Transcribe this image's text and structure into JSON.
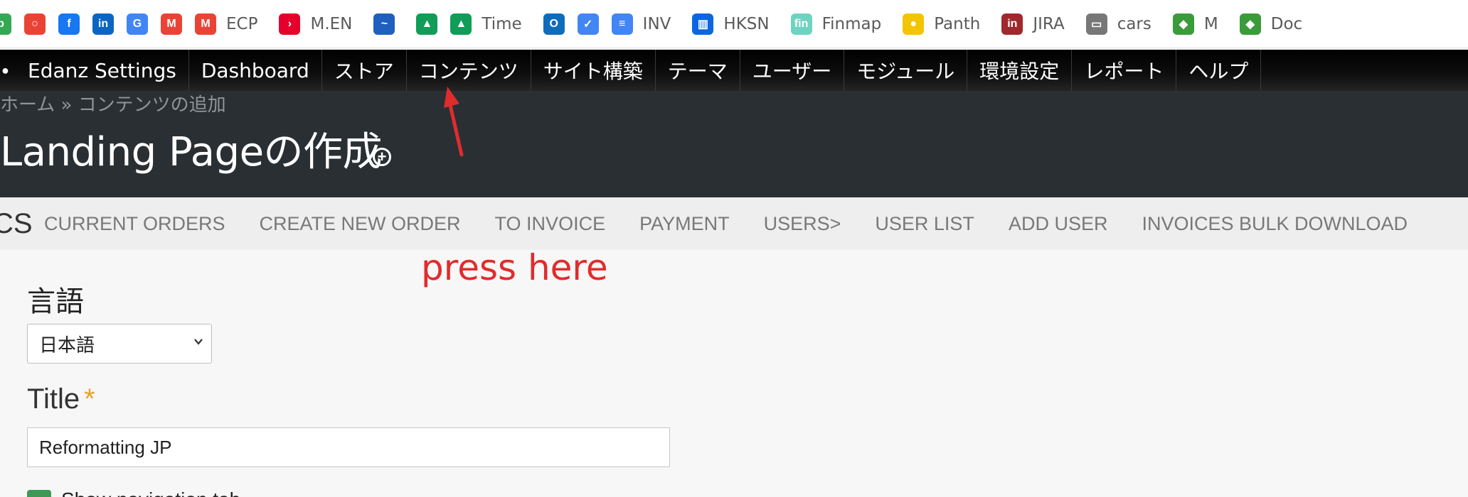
{
  "bookmarks": [
    {
      "icon": "app-icon",
      "label": "",
      "color": "#34a853"
    },
    {
      "icon": "circle-icon",
      "label": "",
      "color": "#ea4335"
    },
    {
      "icon": "facebook-icon",
      "label": "",
      "color": "#1877f2"
    },
    {
      "icon": "linkedin-icon",
      "label": "",
      "color": "#0a66c2"
    },
    {
      "icon": "translate-icon",
      "label": "",
      "color": "#4285f4"
    },
    {
      "icon": "gmail-icon",
      "label": "",
      "color": "#ea4335"
    },
    {
      "icon": "gmail-icon",
      "label": "ECP",
      "color": "#ea4335"
    },
    {
      "icon": "chevron-icon",
      "label": "M.EN",
      "color": "#e4002b"
    },
    {
      "icon": "chart-icon",
      "label": "",
      "color": "#1f5fbf"
    },
    {
      "icon": "drive-icon",
      "label": "",
      "color": "#0f9d58"
    },
    {
      "icon": "drive-icon",
      "label": "Time",
      "color": "#0f9d58"
    },
    {
      "icon": "outlook-icon",
      "label": "",
      "color": "#0f6cbd"
    },
    {
      "icon": "check-icon",
      "label": "",
      "color": "#4285f4"
    },
    {
      "icon": "docs-icon",
      "label": "INV",
      "color": "#4285f4"
    },
    {
      "icon": "trello-icon",
      "label": "HKSN",
      "color": "#0c66e4"
    },
    {
      "icon": "fin-icon",
      "label": "Finmap",
      "color": "#6fd3c2"
    },
    {
      "icon": "bee-icon",
      "label": "Panth",
      "color": "#f3c400"
    },
    {
      "icon": "jira-icon",
      "label": "JIRA",
      "color": "#a0282c"
    },
    {
      "icon": "folder-icon",
      "label": "cars",
      "color": "#777777"
    },
    {
      "icon": "leaf-icon",
      "label": "M",
      "color": "#3a9b3a"
    },
    {
      "icon": "leaf-icon",
      "label": "Doc",
      "color": "#3a9b3a"
    }
  ],
  "admin_menu": [
    "Edanz Settings",
    "Dashboard",
    "ストア",
    "コンテンツ",
    "サイト構築",
    "テーマ",
    "ユーザー",
    "モジュール",
    "環境設定",
    "レポート",
    "ヘルプ"
  ],
  "header": {
    "breadcrumb": "ホーム » コンテンツの追加",
    "title": "Landing Pageの作成"
  },
  "subnav": {
    "edge_text": "CS",
    "items": [
      "CURRENT ORDERS",
      "CREATE NEW ORDER",
      "TO INVOICE",
      "PAYMENT",
      "USERS>",
      "USER LIST",
      "ADD USER",
      "INVOICES BULK DOWNLOAD"
    ]
  },
  "annotation": {
    "text": "press here",
    "color": "#e02c2c"
  },
  "form": {
    "language_label": "言語",
    "language_value": "日本語",
    "title_label": "Title",
    "required_mark": "*",
    "title_value": "Reformatting JP",
    "checkbox_label": "Show navigation tab"
  }
}
